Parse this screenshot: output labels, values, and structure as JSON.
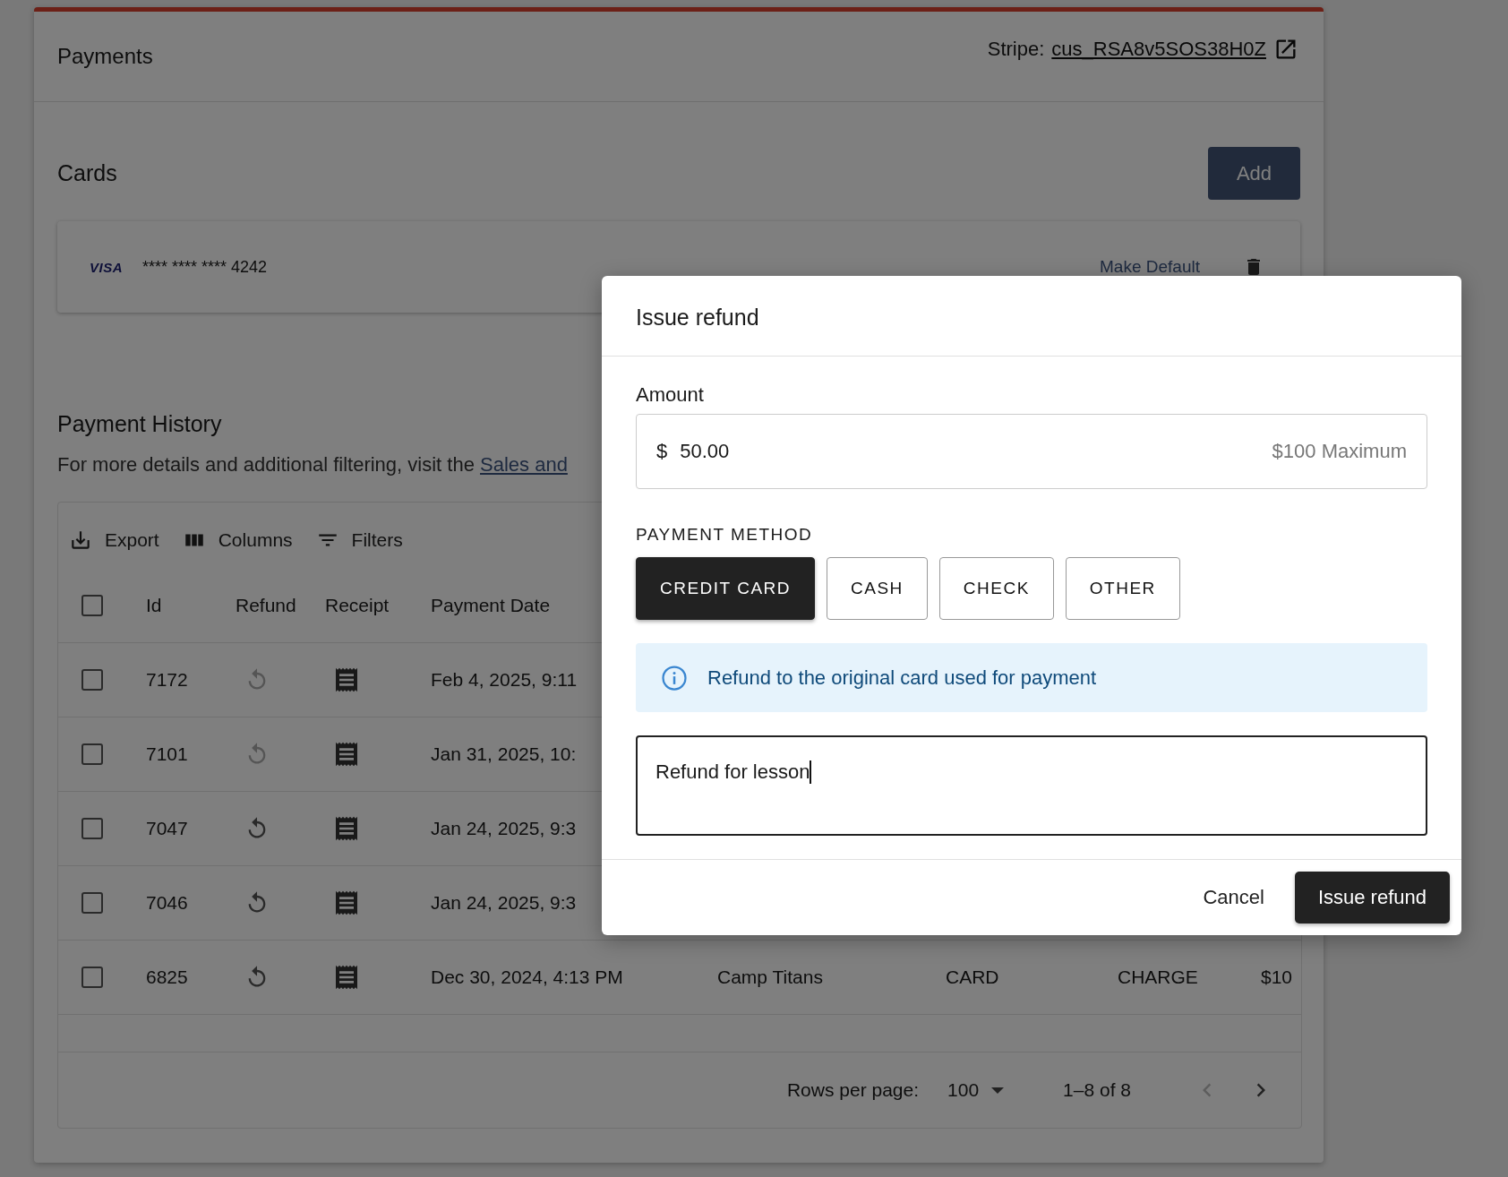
{
  "page": {
    "title": "Payments",
    "stripe_label": "Stripe:",
    "stripe_id": "cus_RSA8v5SOS38H0Z"
  },
  "cards": {
    "title": "Cards",
    "add_button": "Add",
    "items": [
      {
        "brand": "VISA",
        "number": "**** **** **** 4242",
        "make_default": "Make Default"
      }
    ]
  },
  "history": {
    "title": "Payment History",
    "description": "For more details and additional filtering, visit the ",
    "link": "Sales and",
    "toolbar": [
      "Export",
      "Columns",
      "Filters"
    ],
    "header_checked": false,
    "columns": [
      "Id",
      "Refund",
      "Receipt",
      "Payment Date"
    ],
    "rows": [
      {
        "checked": false,
        "id": "7172",
        "refundable": false,
        "date": "Feb 4, 2025, 9:11"
      },
      {
        "checked": false,
        "id": "7101",
        "refundable": false,
        "date": "Jan 31, 2025, 10:"
      },
      {
        "checked": false,
        "id": "7047",
        "refundable": true,
        "date": "Jan 24, 2025, 9:3"
      },
      {
        "checked": false,
        "id": "7046",
        "refundable": true,
        "date": "Jan 24, 2025, 9:3"
      },
      {
        "checked": false,
        "id": "6825",
        "refundable": true,
        "date": "Dec 30, 2024, 4:13 PM",
        "column_5": "Camp Titans",
        "column_6": "CARD",
        "column_7": "CHARGE",
        "column_8": "$10"
      }
    ],
    "footer": {
      "rows_per_page_label": "Rows per page:",
      "rows_per_page": "100",
      "range": "1–8 of 8",
      "prev_disabled": true,
      "next_disabled": false
    }
  },
  "dialog": {
    "title": "Issue refund",
    "amount_label": "Amount",
    "currency": "$",
    "amount": "50.00",
    "maximum": "$100 Maximum",
    "method_label": "PAYMENT METHOD",
    "methods": [
      {
        "label": "CREDIT CARD",
        "selected": true
      },
      {
        "label": "CASH",
        "selected": false
      },
      {
        "label": "CHECK",
        "selected": false
      },
      {
        "label": "OTHER",
        "selected": false
      }
    ],
    "info": "Refund to the original card used for payment",
    "note": "Refund for lesson",
    "cancel": "Cancel",
    "submit": "Issue refund"
  }
}
